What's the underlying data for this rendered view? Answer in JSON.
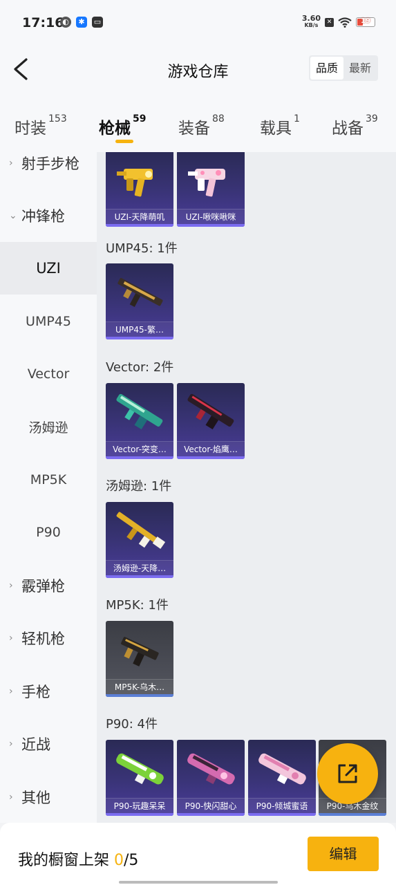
{
  "status_bar": {
    "time": "17:16",
    "net_speed_value": "3.60",
    "net_speed_unit": "KB/s",
    "battery": "19"
  },
  "header": {
    "title": "游戏仓库",
    "sort_options": [
      "品质",
      "最新"
    ],
    "sort_selected": "品质"
  },
  "tabs": [
    {
      "label": "时装",
      "count": "153"
    },
    {
      "label": "枪械",
      "count": "59",
      "active": true
    },
    {
      "label": "装备",
      "count": "88"
    },
    {
      "label": "载具",
      "count": "1"
    },
    {
      "label": "战备",
      "count": "39"
    }
  ],
  "sidebar": {
    "items": [
      {
        "label": "射手步枪",
        "type": "group",
        "expanded": false
      },
      {
        "label": "冲锋枪",
        "type": "group",
        "expanded": true
      },
      {
        "label": "UZI",
        "type": "sub",
        "active": true
      },
      {
        "label": "UMP45",
        "type": "sub"
      },
      {
        "label": "Vector",
        "type": "sub"
      },
      {
        "label": "汤姆逊",
        "type": "sub"
      },
      {
        "label": "MP5K",
        "type": "sub"
      },
      {
        "label": "P90",
        "type": "sub"
      },
      {
        "label": "霰弹枪",
        "type": "group",
        "expanded": false
      },
      {
        "label": "轻机枪",
        "type": "group",
        "expanded": false
      },
      {
        "label": "手枪",
        "type": "group",
        "expanded": false
      },
      {
        "label": "近战",
        "type": "group",
        "expanded": false
      },
      {
        "label": "其他",
        "type": "group",
        "expanded": false
      }
    ]
  },
  "sections": [
    {
      "label": "",
      "cards": [
        {
          "name": "UZI-天降萌叽",
          "icon": "uzi-gold-icon"
        },
        {
          "name": "UZI-啾咪啾咪",
          "icon": "uzi-pink-icon"
        }
      ]
    },
    {
      "label": "UMP45: 1件",
      "cards": [
        {
          "name": "UMP45-繁…",
          "icon": "ump45-gold-icon"
        }
      ]
    },
    {
      "label": "Vector: 2件",
      "cards": [
        {
          "name": "Vector-突变…",
          "icon": "vector-teal-icon"
        },
        {
          "name": "Vector-焰鹰…",
          "icon": "vector-red-icon"
        }
      ]
    },
    {
      "label": "汤姆逊: 1件",
      "cards": [
        {
          "name": "汤姆逊-天降…",
          "icon": "thompson-gold-icon"
        }
      ]
    },
    {
      "label": "MP5K: 1件",
      "cards": [
        {
          "name": "MP5K-乌木…",
          "icon": "mp5k-ebony-icon"
        }
      ]
    },
    {
      "label": "P90: 4件",
      "cards": [
        {
          "name": "P90-玩趣呆呆",
          "icon": "p90-green-icon"
        },
        {
          "name": "P90-快闪甜心",
          "icon": "p90-pink-icon"
        },
        {
          "name": "P90-倾城蜜语",
          "icon": "p90-rose-icon"
        },
        {
          "name": "P90-乌木金纹",
          "icon": "p90-ebony-icon"
        }
      ]
    }
  ],
  "bottom_bar": {
    "window_label": "我的橱窗上架 ",
    "count_current": "0",
    "count_total": "/5",
    "edit_label": "编辑"
  },
  "colors": {
    "accent": "#f6b30f",
    "card_purple": "#3a3478",
    "card_grey": "#4a4c55"
  }
}
